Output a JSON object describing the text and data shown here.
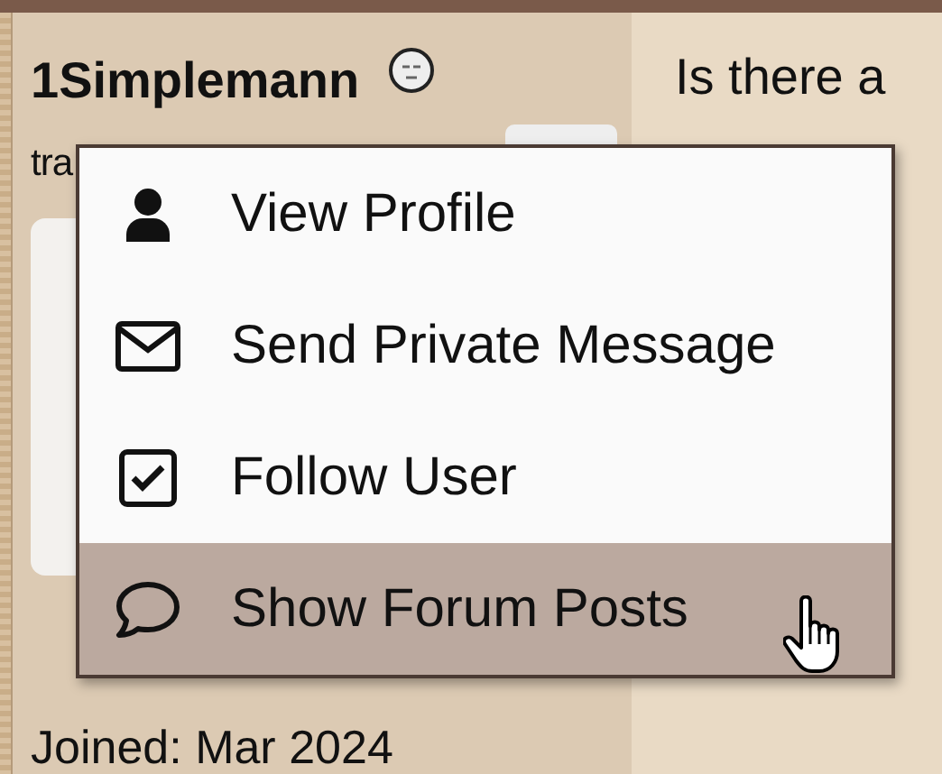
{
  "user": {
    "name": "1Simplemann",
    "subtitle": "tra",
    "joined": "Joined: Mar 2024"
  },
  "post": {
    "text": "Is there a"
  },
  "menu": [
    {
      "label": "View Profile",
      "selected": false
    },
    {
      "label": "Send Private Message",
      "selected": false
    },
    {
      "label": "Follow User",
      "selected": false
    },
    {
      "label": "Show Forum Posts",
      "selected": true
    }
  ]
}
